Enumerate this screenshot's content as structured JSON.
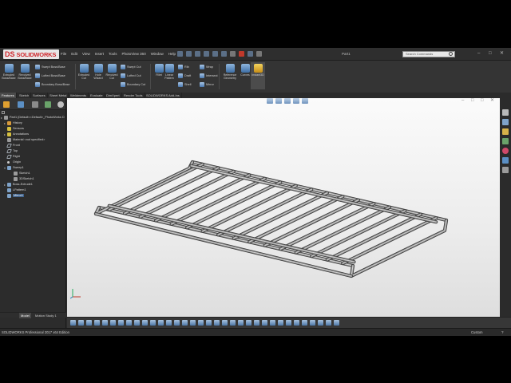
{
  "app": {
    "logo_ds": "DS",
    "logo_name": "SOLIDWORKS",
    "menus": [
      "File",
      "Edit",
      "View",
      "Insert",
      "Tools",
      "PhotoView 360",
      "Window",
      "Help"
    ],
    "doc_title": "Part1",
    "search_placeholder": "Search Commands"
  },
  "ribbon": {
    "big_buttons": [
      {
        "label1": "Extruded",
        "label2": "Boss/Base"
      },
      {
        "label1": "Revolved",
        "label2": "Boss/Base"
      },
      {
        "label1": "Swept",
        "label2": "Boss/Base"
      },
      {
        "label1": "Extruded",
        "label2": "Cut"
      },
      {
        "label1": "Hole",
        "label2": "Wizard"
      },
      {
        "label1": "Revolved",
        "label2": "Cut"
      },
      {
        "label1": "Fillet",
        "label2": ""
      },
      {
        "label1": "Linear",
        "label2": "Pattern"
      },
      {
        "label1": "Reference",
        "label2": "Geometry"
      },
      {
        "label1": "Curves",
        "label2": ""
      },
      {
        "label1": "Instant3D",
        "label2": ""
      }
    ],
    "small_buttons": [
      "Swept Boss/Base",
      "Lofted Boss/Base",
      "Boundary Boss/Base",
      "Swept Cut",
      "Lofted Cut",
      "Boundary Cut",
      "Rib",
      "Draft",
      "Shell",
      "Wrap",
      "Intersect",
      "Mirror"
    ]
  },
  "cmd_tabs": [
    "Features",
    "Sketch",
    "Surfaces",
    "Sheet Metal",
    "Weldments",
    "Evaluate",
    "DimXpert",
    "Render Tools",
    "SOLIDWORKS Add-Ins"
  ],
  "tree": {
    "root": "Part1  (Default<<Default>_PhotoWorks D",
    "items": [
      "History",
      "Sensors",
      "Annotations",
      "Material <not specified>",
      "Front",
      "Top",
      "Right",
      "Origin",
      "Sweep1",
      "Sketch1",
      "3DSketch1",
      "Boss-Extrude1",
      "LPattern1",
      "Mirror1"
    ]
  },
  "fm_bottom": [
    "Model",
    "Motion Study 1"
  ],
  "status": {
    "text": "SOLIDWORKS Professional 2017 x64 Edition",
    "units": "Custom",
    "help": "?"
  },
  "colors": {
    "accent": "#d0262b",
    "selection": "#3b5f8a",
    "background": "#f4f4f4"
  }
}
